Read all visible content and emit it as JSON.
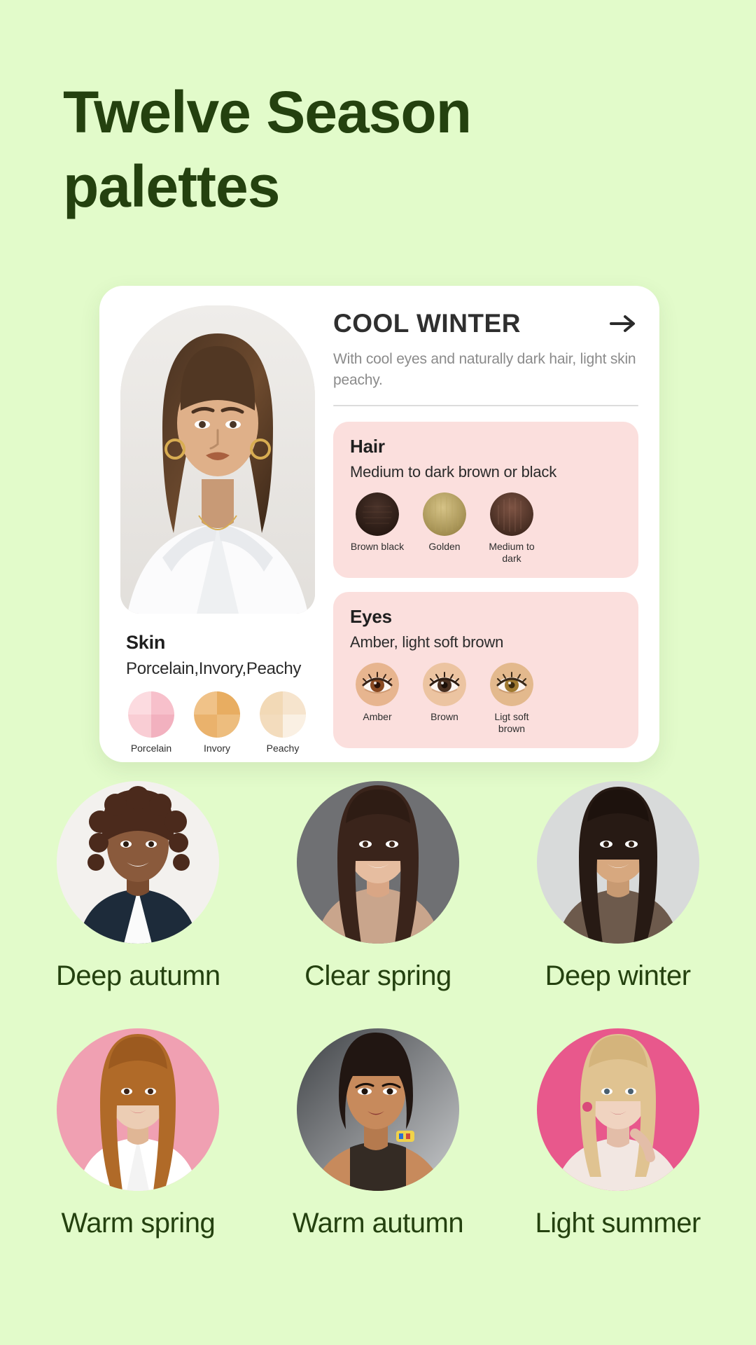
{
  "theme": {
    "background": "#e2fbca",
    "title_color": "#24410f",
    "card_background": "#ffffff",
    "trait_card_background": "#fbdfdd",
    "heading_color": "#2f2f2f",
    "muted_text": "#8b8b8b"
  },
  "page": {
    "title": "Twelve Season palettes"
  },
  "featured": {
    "season_name": "COOL WINTER",
    "description": "With cool eyes and naturally dark hair, light skin peachy.",
    "next_arrow_icon": "arrow-right-icon",
    "portrait_alt": "Cool winter model portrait",
    "skin": {
      "title": "Skin",
      "subtitle": "Porcelain,Invory,Peachy",
      "swatches": [
        {
          "label": "Porcelain",
          "color": "#f6c3cb"
        },
        {
          "label": "Invory",
          "color": "#eab26c"
        },
        {
          "label": "Peachy",
          "color": "#f3dcbd"
        }
      ]
    },
    "hair": {
      "title": "Hair",
      "subtitle": "Medium to dark brown or black",
      "swatches": [
        {
          "label": "Brown black",
          "color": "#33211c"
        },
        {
          "label": "Golden",
          "color": "#b8a05e"
        },
        {
          "label": "Medium to dark",
          "color": "#5c3a31"
        }
      ]
    },
    "eyes": {
      "title": "Eyes",
      "subtitle": "Amber, light soft brown",
      "swatches": [
        {
          "label": "Amber",
          "color": "#8a4a22"
        },
        {
          "label": "Brown",
          "color": "#4a3020"
        },
        {
          "label": "Ligt soft brown",
          "color": "#a07a30"
        }
      ]
    }
  },
  "seasons": [
    {
      "label": "Deep autumn",
      "bg": "#f3f1ee",
      "skin": "#8a5a3c",
      "hair": "#4b2a1c",
      "top": "#1d2b3a"
    },
    {
      "label": "Clear spring",
      "bg": "#6f7073",
      "skin": "#e6bda0",
      "hair": "#3a241b",
      "top": "#c9a58c"
    },
    {
      "label": "Deep winter",
      "bg": "#d8dada",
      "skin": "#d7a87f",
      "hair": "#271a14",
      "top": "#6d5a4c"
    },
    {
      "label": "Warm spring",
      "bg": "#f0a0b2",
      "skin": "#eccdb4",
      "hair": "#b06a28",
      "top": "#ffffff"
    },
    {
      "label": "Warm autumn",
      "bg": "#8f9296",
      "skin": "#c78a5c",
      "hair": "#211612",
      "top": "#1a1a1a"
    },
    {
      "label": "Light summer",
      "bg": "#e8588c",
      "skin": "#f0d3c0",
      "hair": "#e0c391",
      "top": "#f2e7e2"
    }
  ]
}
